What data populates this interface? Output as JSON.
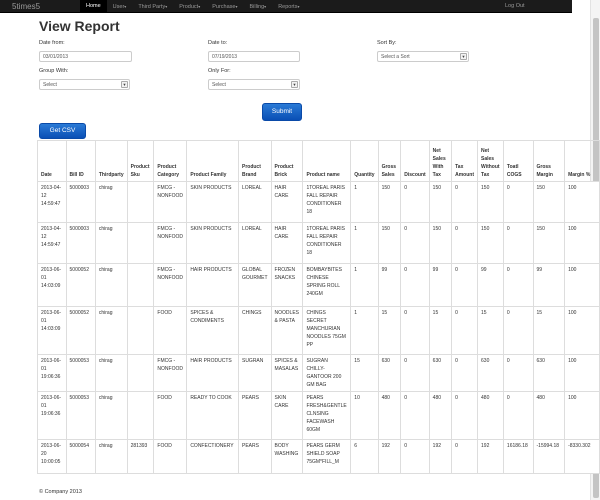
{
  "brand": "5times5",
  "nav": {
    "items": [
      {
        "label": "Home",
        "caret": ""
      },
      {
        "label": "User",
        "caret": "▾"
      },
      {
        "label": "Third Party",
        "caret": "▾"
      },
      {
        "label": "Product",
        "caret": "▾"
      },
      {
        "label": "Purchase",
        "caret": "▾"
      },
      {
        "label": "Billing",
        "caret": "▾"
      },
      {
        "label": "Reports",
        "caret": "▾"
      }
    ],
    "logout": "Log Out"
  },
  "page_title": "View Report",
  "filters": {
    "date_from_label": "Date from:",
    "date_from_value": "03/01/2013",
    "date_to_label": "Date to:",
    "date_to_value": "07/19/2013",
    "sort_by_label": "Sort By:",
    "sort_by_value": "Select a Sort",
    "group_with_label": "Group With:",
    "group_with_value": "Select",
    "only_for_label": "Only For:",
    "only_for_value": "Select"
  },
  "submit_label": "Submit",
  "csv_label": "Get CSV",
  "table": {
    "headers": [
      "Date",
      "Bill ID",
      "Thirdparty",
      "Product Sku",
      "Product Category",
      "Product Family",
      "Product Brand",
      "Product Brick",
      "Product name",
      "Quantity",
      "Gross Sales",
      "Discount",
      "Net Sales With Tax",
      "Tax Amount",
      "Net Sales Without Tax",
      "Toatl COGS",
      "Gross Margin",
      "Margin %"
    ],
    "rows": [
      [
        "2013-04-12 14:59:47",
        "5000003",
        "chirag",
        "",
        "FMCG - NONFOOD",
        "SKIN PRODUCTS",
        "LOREAL",
        "HAIR CARE",
        "1TOREAL PARIS FALL REPAIR CONDITIONER 18",
        "1",
        "150",
        "0",
        "150",
        "0",
        "150",
        "0",
        "150",
        "100"
      ],
      [
        "2013-04-12 14:59:47",
        "5000003",
        "chirag",
        "",
        "FMCG - NONFOOD",
        "SKIN PRODUCTS",
        "LOREAL",
        "HAIR CARE",
        "1TOREAL PARIS FALL REPAIR CONDITIONER 18",
        "1",
        "150",
        "0",
        "150",
        "0",
        "150",
        "0",
        "150",
        "100"
      ],
      [
        "2013-06-01 14:03:09",
        "5000052",
        "chirag",
        "",
        "FMCG - NONFOOD",
        "HAIR PRODUCTS",
        "GLOBAL GOURMET",
        "FROZEN SNACKS",
        "BOMBAYBITES CHINESE SPRING ROLL 240GM",
        "1",
        "99",
        "0",
        "99",
        "0",
        "99",
        "0",
        "99",
        "100"
      ],
      [
        "2013-06-01 14:03:09",
        "5000052",
        "chirag",
        "",
        "FOOD",
        "SPICES & CONDIMENTS",
        "CHINGS",
        "NOODLES & PASTA",
        "CHINGS SECRET MANCHURIAN NOODLES 75GM PP",
        "1",
        "15",
        "0",
        "15",
        "0",
        "15",
        "0",
        "15",
        "100"
      ],
      [
        "2013-06-01 19:06:36",
        "5000053",
        "chirag",
        "",
        "FMCG - NONFOOD",
        "HAIR PRODUCTS",
        "SUGRAN",
        "SPICES & MASALAS",
        "SUGRAN CHILLY-GANTOOR 200 GM BAG",
        "15",
        "630",
        "0",
        "630",
        "0",
        "630",
        "0",
        "630",
        "100"
      ],
      [
        "2013-06-01 19:06:36",
        "5000053",
        "chirag",
        "",
        "FOOD",
        "READY TO COOK",
        "PEARS",
        "SKIN CARE",
        "PEARS FRESH&GENTLE CLNSING FACEWASH 60GM",
        "10",
        "480",
        "0",
        "480",
        "0",
        "480",
        "0",
        "480",
        "100"
      ],
      [
        "2013-06-20 10:00:05",
        "5000054",
        "chirag",
        "281393",
        "FOOD",
        "CONFECTIONERY",
        "PEARS",
        "BODY WASHING",
        "PEARS GERM SHIELD SOAP 75GM*FILL_M",
        "6",
        "192",
        "0",
        "192",
        "0",
        "192",
        "16186.18",
        "-15994.18",
        "-8330.302"
      ]
    ]
  },
  "footer": "© Company 2013"
}
